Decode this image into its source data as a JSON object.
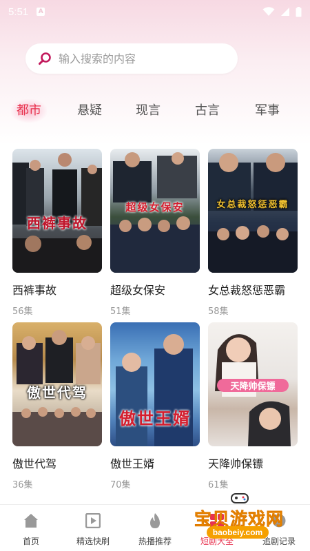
{
  "status_bar": {
    "time": "5:51",
    "notification_icon": "a-icon"
  },
  "search": {
    "placeholder": "输入搜索的内容",
    "value": ""
  },
  "tabs": [
    {
      "label": "都市",
      "active": true
    },
    {
      "label": "悬疑",
      "active": false
    },
    {
      "label": "现言",
      "active": false
    },
    {
      "label": "古言",
      "active": false
    },
    {
      "label": "军事",
      "active": false
    }
  ],
  "dramas": [
    {
      "title": "西裤事故",
      "episodes": "56集",
      "poster_text": "西裤事故"
    },
    {
      "title": "超级女保安",
      "episodes": "51集",
      "poster_text": "超级女保安"
    },
    {
      "title": "女总裁怒惩恶霸",
      "episodes": "58集",
      "poster_text": "女总裁怒惩恶霸"
    },
    {
      "title": "傲世代驾",
      "episodes": "36集",
      "poster_text": "傲世代驾"
    },
    {
      "title": "傲世王婿",
      "episodes": "70集",
      "poster_text": "傲世王婿"
    },
    {
      "title": "天降帅保镖",
      "episodes": "61集",
      "poster_text": "天降帅保镖"
    }
  ],
  "bottom_nav": [
    {
      "label": "首页",
      "icon": "home-icon"
    },
    {
      "label": "精选快刷",
      "icon": "play-icon"
    },
    {
      "label": "热播推荐",
      "icon": "flame-icon"
    },
    {
      "label": "短剧大全",
      "icon": "grid-icon"
    },
    {
      "label": "追剧记录",
      "icon": "history-icon"
    }
  ],
  "watermark": {
    "text": "宝贝游戏网",
    "url": "baobeiy.com"
  },
  "colors": {
    "accent": "#e8334f",
    "search_icon": "#c2185b",
    "watermark": "#f5a000"
  }
}
